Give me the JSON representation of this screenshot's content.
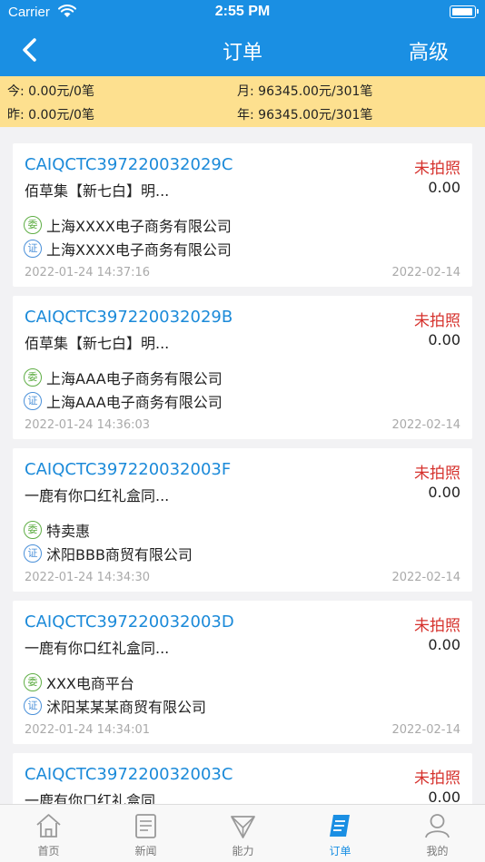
{
  "status_bar": {
    "carrier": "Carrier",
    "time": "2:55 PM"
  },
  "nav": {
    "title": "订单",
    "right_action": "高级"
  },
  "summary": {
    "today": "今: 0.00元/0笔",
    "month": "月: 96345.00元/301笔",
    "yesterday": "昨: 0.00元/0笔",
    "year": "年: 96345.00元/301笔"
  },
  "orders": [
    {
      "order_no": "CAIQCTC397220032029C",
      "status": "未拍照",
      "product": "佰草集【新七白】明...",
      "amount": "0.00",
      "wei_badge": "委",
      "entrusting_company": "上海XXXX电子商务有限公司",
      "zheng_badge": "证",
      "certifying_company": "上海XXXX电子商务有限公司",
      "created_at": "2022-01-24 14:37:16",
      "date": "2022-02-14"
    },
    {
      "order_no": "CAIQCTC397220032029B",
      "status": "未拍照",
      "product": "佰草集【新七白】明...",
      "amount": "0.00",
      "wei_badge": "委",
      "entrusting_company": "上海AAA电子商务有限公司",
      "zheng_badge": "证",
      "certifying_company": "上海AAA电子商务有限公司",
      "created_at": "2022-01-24 14:36:03",
      "date": "2022-02-14"
    },
    {
      "order_no": "CAIQCTC397220032003F",
      "status": "未拍照",
      "product": "一鹿有你口红礼盒同...",
      "amount": "0.00",
      "wei_badge": "委",
      "entrusting_company": "特卖惠",
      "zheng_badge": "证",
      "certifying_company": "沭阳BBB商贸有限公司",
      "created_at": "2022-01-24 14:34:30",
      "date": "2022-02-14"
    },
    {
      "order_no": "CAIQCTC397220032003D",
      "status": "未拍照",
      "product": "一鹿有你口红礼盒同...",
      "amount": "0.00",
      "wei_badge": "委",
      "entrusting_company": "XXX电商平台",
      "zheng_badge": "证",
      "certifying_company": "沭阳某某某商贸有限公司",
      "created_at": "2022-01-24 14:34:01",
      "date": "2022-02-14"
    },
    {
      "order_no": "CAIQCTC397220032003C",
      "status": "未拍照",
      "product": "一鹿有你口红礼盒同...",
      "amount": "0.00"
    }
  ],
  "tabs": [
    {
      "label": "首页"
    },
    {
      "label": "新闻"
    },
    {
      "label": "能力"
    },
    {
      "label": "订单"
    },
    {
      "label": "我的"
    }
  ],
  "colors": {
    "brand": "#1a8fe3",
    "summary_bg": "#fde08f",
    "status_red": "#d6322d",
    "order_link": "#1b8ad9"
  },
  "icons": {
    "back": "chevron-left-icon",
    "home": "home-icon",
    "news": "newspaper-icon",
    "ability": "paper-plane-icon",
    "orders": "order-list-icon",
    "profile": "user-icon"
  }
}
